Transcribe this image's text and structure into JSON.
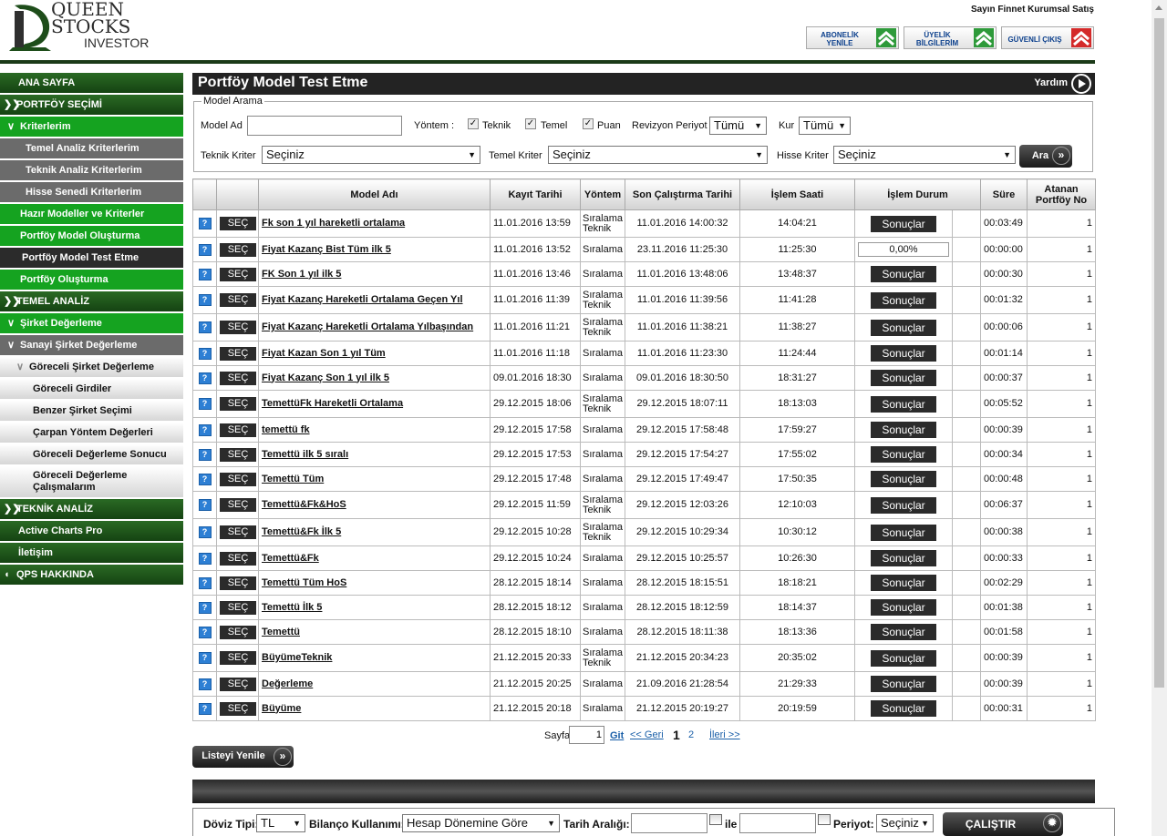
{
  "logo": {
    "line1": "QUEEN",
    "line2": "STOCKS",
    "line3": "INVESTOR"
  },
  "header": {
    "greeting": "Sayın Finnet Kurumsal Satış",
    "buttons": [
      {
        "label": "ABONELİK YENİLE",
        "color": "#2e9a3a"
      },
      {
        "label": "ÜYELİK BİLGİLERİM",
        "color": "#2e9a3a"
      },
      {
        "label": "GÜVENLİ ÇIKIŞ",
        "color": "#d42a2a"
      }
    ]
  },
  "sidebar": {
    "items": [
      {
        "label": "ANA SAYFA"
      },
      {
        "label": "PORTFÖY SEÇİMİ"
      },
      {
        "label": "Kriterlerim"
      },
      {
        "label": "Temel Analiz Kriterlerim"
      },
      {
        "label": "Teknik Analiz Kriterlerim"
      },
      {
        "label": "Hisse Senedi Kriterlerim"
      },
      {
        "label": "Hazır Modeller ve Kriterler"
      },
      {
        "label": "Portföy Model Oluşturma"
      },
      {
        "label": "Portföy Model Test Etme"
      },
      {
        "label": "Portföy Oluşturma"
      },
      {
        "label": "TEMEL ANALİZ"
      },
      {
        "label": "Şirket Değerleme"
      },
      {
        "label": "Sanayi Şirket Değerleme"
      },
      {
        "label": "Göreceli Şirket Değerleme"
      },
      {
        "label": "Göreceli Girdiler"
      },
      {
        "label": "Benzer Şirket Seçimi"
      },
      {
        "label": "Çarpan Yöntem Değerleri"
      },
      {
        "label": "Göreceli Değerleme Sonucu"
      },
      {
        "label": "Göreceli Değerleme Çalışmalarım"
      },
      {
        "label": "TEKNİK ANALİZ"
      },
      {
        "label": "Active Charts Pro"
      },
      {
        "label": "İletişim"
      },
      {
        "label": "QPS HAKKINDA"
      }
    ]
  },
  "page": {
    "title": "Portföy Model Test Etme",
    "help": "Yardım"
  },
  "search": {
    "legend": "Model Arama",
    "model_ad_label": "Model Ad",
    "model_ad_value": "",
    "yontem_label": "Yöntem :",
    "yontem_options": [
      "Teknik",
      "Temel",
      "Puan"
    ],
    "revizyon_label": "Revizyon Periyot",
    "revizyon_value": "Tümü",
    "kur_label": "Kur",
    "kur_value": "Tümü",
    "teknik_label": "Teknik Kriter",
    "teknik_value": "Seçiniz",
    "temel_label": "Temel Kriter",
    "temel_value": "Seçiniz",
    "hisse_label": "Hisse Kriter",
    "hisse_value": "Seçiniz",
    "ara_label": "Ara"
  },
  "table": {
    "headers": [
      "Model Adı",
      "Kayıt Tarihi",
      "Yöntem",
      "Son Çalıştırma Tarihi",
      "İşlem Saati",
      "İşlem Durum",
      "Süre",
      "Atanan Portföy No"
    ],
    "select_label": "SEÇ",
    "result_label": "Sonuçlar",
    "rows": [
      {
        "name": "Fk son 1 yıl hareketli ortalama",
        "kayit": "11.01.2016 13:59",
        "yontem": "Sıralama Teknik",
        "son": "11.01.2016 14:00:32",
        "saat": "14:04:21",
        "durum": "Sonuçlar",
        "sure": "00:03:49",
        "no": "1"
      },
      {
        "name": "Fiyat Kazanç Bist Tüm ilk 5",
        "kayit": "11.01.2016 13:52",
        "yontem": "Sıralama",
        "son": "23.11.2016 11:25:30",
        "saat": "11:25:30",
        "durum": "0,00%",
        "sure": "00:00:00",
        "no": "1"
      },
      {
        "name": "FK Son 1 yıl ilk 5",
        "kayit": "11.01.2016 13:46",
        "yontem": "Sıralama",
        "son": "11.01.2016 13:48:06",
        "saat": "13:48:37",
        "durum": "Sonuçlar",
        "sure": "00:00:30",
        "no": "1"
      },
      {
        "name": "Fiyat Kazanç Hareketli Ortalama Geçen Yıl",
        "kayit": "11.01.2016 11:39",
        "yontem": "Sıralama Teknik",
        "son": "11.01.2016 11:39:56",
        "saat": "11:41:28",
        "durum": "Sonuçlar",
        "sure": "00:01:32",
        "no": "1"
      },
      {
        "name": "Fiyat Kazanç Hareketli Ortalama Yılbaşından",
        "kayit": "11.01.2016 11:21",
        "yontem": "Sıralama Teknik",
        "son": "11.01.2016 11:38:21",
        "saat": "11:38:27",
        "durum": "Sonuçlar",
        "sure": "00:00:06",
        "no": "1"
      },
      {
        "name": "Fiyat Kazan Son 1 yıl Tüm",
        "kayit": "11.01.2016 11:18",
        "yontem": "Sıralama",
        "son": "11.01.2016 11:23:30",
        "saat": "11:24:44",
        "durum": "Sonuçlar",
        "sure": "00:01:14",
        "no": "1"
      },
      {
        "name": "Fiyat Kazanç Son 1 yıl ilk 5",
        "kayit": "09.01.2016 18:30",
        "yontem": "Sıralama",
        "son": "09.01.2016 18:30:50",
        "saat": "18:31:27",
        "durum": "Sonuçlar",
        "sure": "00:00:37",
        "no": "1"
      },
      {
        "name": "TemettüFk Hareketli Ortalama",
        "kayit": "29.12.2015 18:06",
        "yontem": "Sıralama Teknik",
        "son": "29.12.2015 18:07:11",
        "saat": "18:13:03",
        "durum": "Sonuçlar",
        "sure": "00:05:52",
        "no": "1"
      },
      {
        "name": "temettü fk",
        "kayit": "29.12.2015 17:58",
        "yontem": "Sıralama",
        "son": "29.12.2015 17:58:48",
        "saat": "17:59:27",
        "durum": "Sonuçlar",
        "sure": "00:00:39",
        "no": "1"
      },
      {
        "name": "Temettü ilk 5 sıralı",
        "kayit": "29.12.2015 17:53",
        "yontem": "Sıralama",
        "son": "29.12.2015 17:54:27",
        "saat": "17:55:02",
        "durum": "Sonuçlar",
        "sure": "00:00:34",
        "no": "1"
      },
      {
        "name": "Temettü Tüm",
        "kayit": "29.12.2015 17:48",
        "yontem": "Sıralama",
        "son": "29.12.2015 17:49:47",
        "saat": "17:50:35",
        "durum": "Sonuçlar",
        "sure": "00:00:48",
        "no": "1"
      },
      {
        "name": "Temettü&Fk&HoS",
        "kayit": "29.12.2015 11:59",
        "yontem": "Sıralama Teknik",
        "son": "29.12.2015 12:03:26",
        "saat": "12:10:03",
        "durum": "Sonuçlar",
        "sure": "00:06:37",
        "no": "1"
      },
      {
        "name": "Temettü&Fk İlk 5",
        "kayit": "29.12.2015 10:28",
        "yontem": "Sıralama Teknik",
        "son": "29.12.2015 10:29:34",
        "saat": "10:30:12",
        "durum": "Sonuçlar",
        "sure": "00:00:38",
        "no": "1"
      },
      {
        "name": "Temettü&Fk",
        "kayit": "29.12.2015 10:24",
        "yontem": "Sıralama",
        "son": "29.12.2015 10:25:57",
        "saat": "10:26:30",
        "durum": "Sonuçlar",
        "sure": "00:00:33",
        "no": "1"
      },
      {
        "name": "Temettü Tüm HoS",
        "kayit": "28.12.2015 18:14",
        "yontem": "Sıralama",
        "son": "28.12.2015 18:15:51",
        "saat": "18:18:21",
        "durum": "Sonuçlar",
        "sure": "00:02:29",
        "no": "1"
      },
      {
        "name": "Temettü İlk 5",
        "kayit": "28.12.2015 18:12",
        "yontem": "Sıralama",
        "son": "28.12.2015 18:12:59",
        "saat": "18:14:37",
        "durum": "Sonuçlar",
        "sure": "00:01:38",
        "no": "1"
      },
      {
        "name": "Temettü",
        "kayit": "28.12.2015 18:10",
        "yontem": "Sıralama",
        "son": "28.12.2015 18:11:38",
        "saat": "18:13:36",
        "durum": "Sonuçlar",
        "sure": "00:01:58",
        "no": "1"
      },
      {
        "name": "BüyümeTeknik",
        "kayit": "21.12.2015 20:33",
        "yontem": "Sıralama Teknik",
        "son": "21.12.2015 20:34:23",
        "saat": "20:35:02",
        "durum": "Sonuçlar",
        "sure": "00:00:39",
        "no": "1"
      },
      {
        "name": "Değerleme",
        "kayit": "21.12.2015 20:25",
        "yontem": "Sıralama",
        "son": "21.09.2016 21:28:54",
        "saat": "21:29:33",
        "durum": "Sonuçlar",
        "sure": "00:00:39",
        "no": "1"
      },
      {
        "name": "Büyüme",
        "kayit": "21.12.2015 20:18",
        "yontem": "Sıralama",
        "son": "21.12.2015 20:19:27",
        "saat": "20:19:59",
        "durum": "Sonuçlar",
        "sure": "00:00:31",
        "no": "1"
      }
    ]
  },
  "pager": {
    "label": "Sayfa",
    "value": "1",
    "go": "Git",
    "prev": "<< Geri",
    "current": "1",
    "next_page": "2",
    "next": "İleri >>"
  },
  "refresh_label": "Listeyi Yenile",
  "filter": {
    "doviz_label": "Döviz Tipi:",
    "doviz_value": "TL",
    "bilanco_label": "Bilanço Kullanımı:",
    "bilanco_value": "Hesap Dönemine Göre",
    "tarih_label": "Tarih Aralığı:",
    "ile_label": "ile",
    "periyot_label": "Periyot:",
    "periyot_value": "Seçiniz",
    "run_label": "ÇALIŞTIR"
  }
}
